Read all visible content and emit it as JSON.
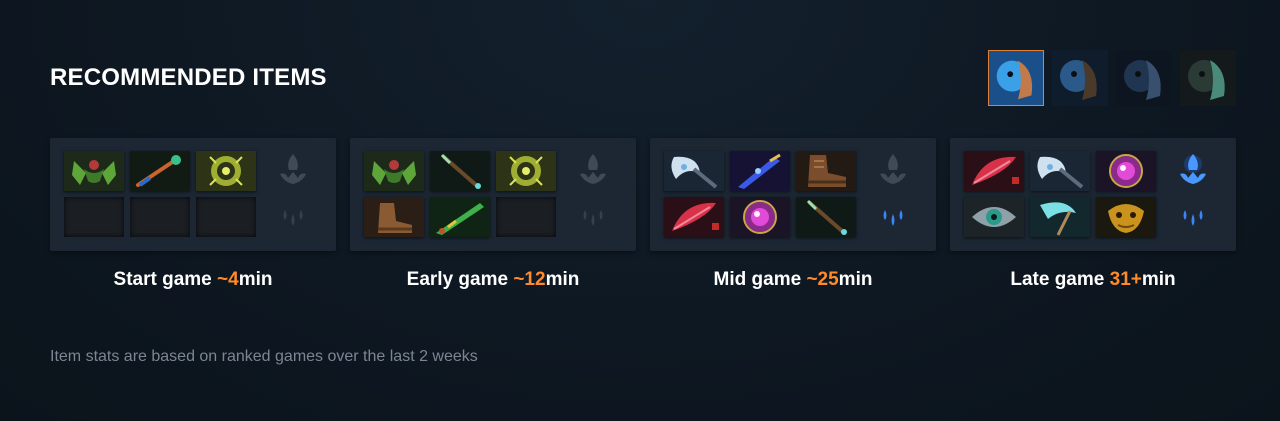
{
  "section": {
    "title": "RECOMMENDED ITEMS"
  },
  "heroes": [
    {
      "name": "hero-portrait-1-icon",
      "selected": true,
      "colors": [
        "#1b4f8a",
        "#3aa0e8",
        "#c27a4a"
      ]
    },
    {
      "name": "hero-portrait-2-icon",
      "selected": false,
      "colors": [
        "#0f1c2c",
        "#2b5a8a",
        "#4b3a2a"
      ]
    },
    {
      "name": "hero-portrait-3-icon",
      "selected": false,
      "colors": [
        "#0d1520",
        "#1f3550",
        "#38506e"
      ]
    },
    {
      "name": "hero-portrait-4-icon",
      "selected": false,
      "colors": [
        "#141a1c",
        "#2a3b36",
        "#4a8a7a"
      ]
    }
  ],
  "stages": [
    {
      "label": "Start game ",
      "time": "~4",
      "unit": "min",
      "items": [
        "tango-helmet-icon",
        "blue-staff-icon",
        "gold-ring-icon",
        "empty",
        "empty",
        "empty"
      ],
      "neutral": "inactive",
      "shard": "inactive"
    },
    {
      "label": "Early game ",
      "time": "~12",
      "unit": "min",
      "items": [
        "tango-helmet-icon",
        "green-wand-icon",
        "gold-ring-icon",
        "boots-icon",
        "green-blade-icon",
        "empty"
      ],
      "neutral": "inactive",
      "shard": "inactive"
    },
    {
      "label": "Mid game ",
      "time": "~25",
      "unit": "min",
      "items": [
        "white-axe-icon",
        "blue-dagger-icon",
        "brown-boots-icon",
        "red-feather-icon",
        "purple-orb-icon",
        "green-wand-icon"
      ],
      "neutral": "inactive",
      "shard": "active"
    },
    {
      "label": "Late game ",
      "time": "31+",
      "unit": "min",
      "items": [
        "red-feather-icon",
        "white-axe-icon",
        "purple-orb-icon",
        "teal-eye-icon",
        "cyan-scythe-icon",
        "gold-mask-icon"
      ],
      "neutral": "active",
      "shard": "active"
    }
  ],
  "footer": {
    "note": "Item stats are based on ranked games over the last 2 weeks"
  },
  "colors": {
    "accent": "#ff8a2b",
    "card": "#1c2733",
    "active_glow": "#3a8cff"
  }
}
